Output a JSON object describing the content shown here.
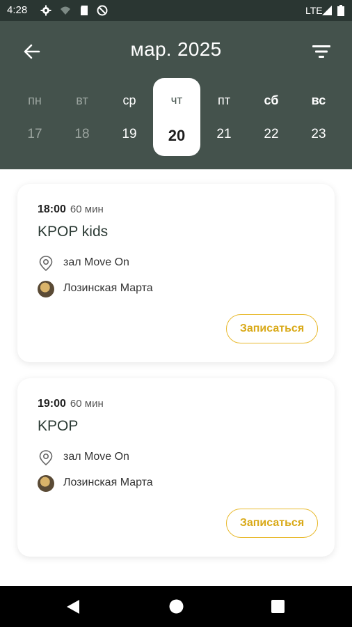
{
  "status_bar": {
    "time": "4:28",
    "left_icons": [
      "gear-icon",
      "wifi-icon",
      "sd-card-icon",
      "circle-slash-icon"
    ],
    "network": "LTE",
    "right_icons": [
      "signal-icon",
      "battery-icon"
    ]
  },
  "header": {
    "title": "мар. 2025",
    "back_icon": "arrow-left-icon",
    "filter_icon": "filter-icon"
  },
  "week": [
    {
      "dow": "пн",
      "num": "17",
      "state": "past"
    },
    {
      "dow": "вт",
      "num": "18",
      "state": "past"
    },
    {
      "dow": "ср",
      "num": "19",
      "state": "future"
    },
    {
      "dow": "чт",
      "num": "20",
      "state": "selected"
    },
    {
      "dow": "пт",
      "num": "21",
      "state": "future"
    },
    {
      "dow": "сб",
      "num": "22",
      "state": "weekend"
    },
    {
      "dow": "вс",
      "num": "23",
      "state": "weekend"
    }
  ],
  "sessions": [
    {
      "time": "18:00",
      "duration": "60 мин",
      "title": "KPOP kids",
      "location": "зал Move On",
      "trainer": "Лозинская Марта",
      "button": "Записаться"
    },
    {
      "time": "19:00",
      "duration": "60 мин",
      "title": "KPOP",
      "location": "зал Move On",
      "trainer": "Лозинская Марта",
      "button": "Записаться"
    }
  ],
  "colors": {
    "header_bg": "#44524c",
    "status_bg": "#2a3632",
    "accent": "#e8b92c",
    "card_bg": "#ffffff"
  },
  "nav_bar": {
    "icons": [
      "back-triangle-icon",
      "home-circle-icon",
      "recents-square-icon"
    ]
  }
}
